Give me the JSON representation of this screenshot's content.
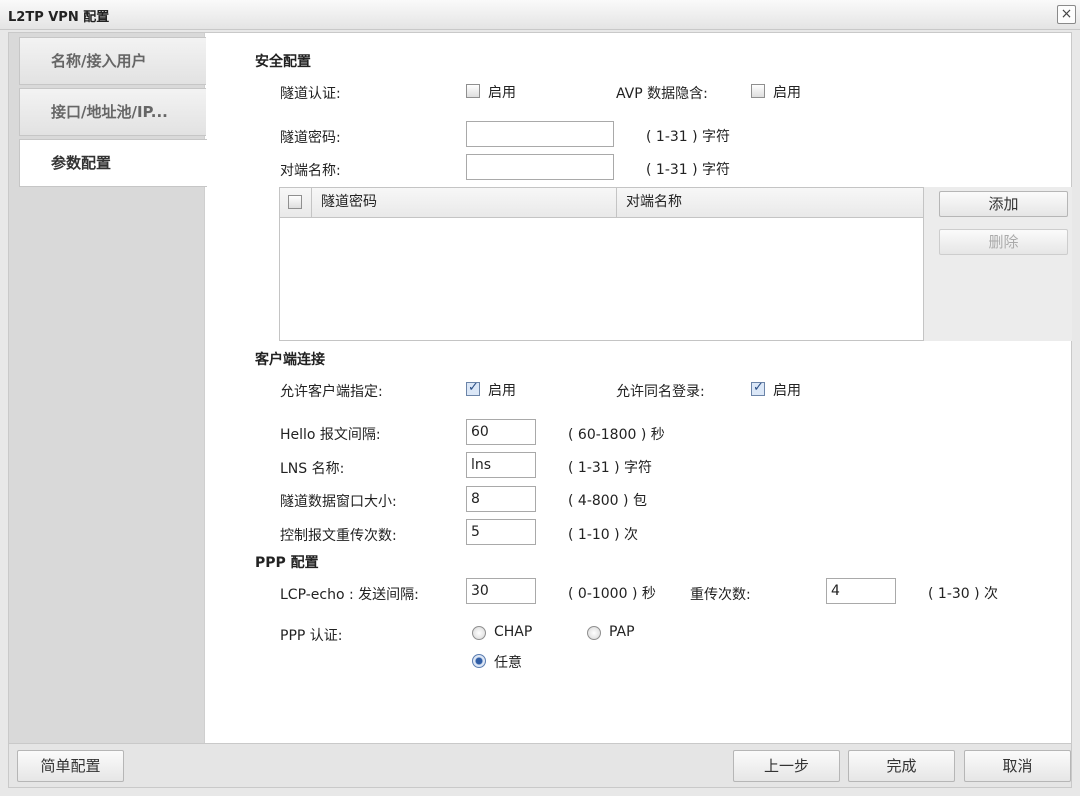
{
  "window": {
    "title": "L2TP VPN 配置",
    "close_icon": "×"
  },
  "sidebar": {
    "items": [
      {
        "label": "名称/接入用户"
      },
      {
        "label": "接口/地址池/IP..."
      },
      {
        "label": "参数配置"
      }
    ]
  },
  "security": {
    "section_title": "安全配置",
    "tunnel_auth_label": "隧道认证:",
    "tunnel_auth_enable": "启用",
    "avp_label": "AVP 数据隐含:",
    "avp_enable": "启用",
    "tunnel_password_label": "隧道密码:",
    "tunnel_password_value": "",
    "tunnel_password_hint": "( 1-31 ) 字符",
    "peer_name_label": "对端名称:",
    "peer_name_value": "",
    "peer_name_hint": "( 1-31 ) 字符",
    "table_headers": [
      "隧道密码",
      "对端名称"
    ],
    "add_label": "添加",
    "delete_label": "删除"
  },
  "client": {
    "section_title": "客户端连接",
    "allow_client_label": "允许客户端指定:",
    "allow_client_enable": "启用",
    "allow_same_label": "允许同名登录:",
    "allow_same_enable": "启用",
    "hello_label": "Hello 报文间隔:",
    "hello_value": "60",
    "hello_hint": "( 60-1800 ) 秒",
    "lns_label": "LNS 名称:",
    "lns_value": "lns",
    "lns_hint": "( 1-31 ) 字符",
    "window_label": "隧道数据窗口大小:",
    "window_value": "8",
    "window_hint": "( 4-800 ) 包",
    "retrans_label": "控制报文重传次数:",
    "retrans_value": "5",
    "retrans_hint": "( 1-10 ) 次"
  },
  "ppp": {
    "section_title": "PPP 配置",
    "lcp_label": "LCP-echo : 发送间隔:",
    "lcp_value": "30",
    "lcp_hint": "( 0-1000 ) 秒",
    "retry_label": "重传次数:",
    "retry_value": "4",
    "retry_hint": "( 1-30 ) 次",
    "auth_label": "PPP 认证:",
    "auth_options": [
      "CHAP",
      "PAP",
      "任意"
    ],
    "auth_selected": "任意"
  },
  "footer": {
    "simple_label": "简单配置",
    "prev_label": "上一步",
    "finish_label": "完成",
    "cancel_label": "取消"
  }
}
